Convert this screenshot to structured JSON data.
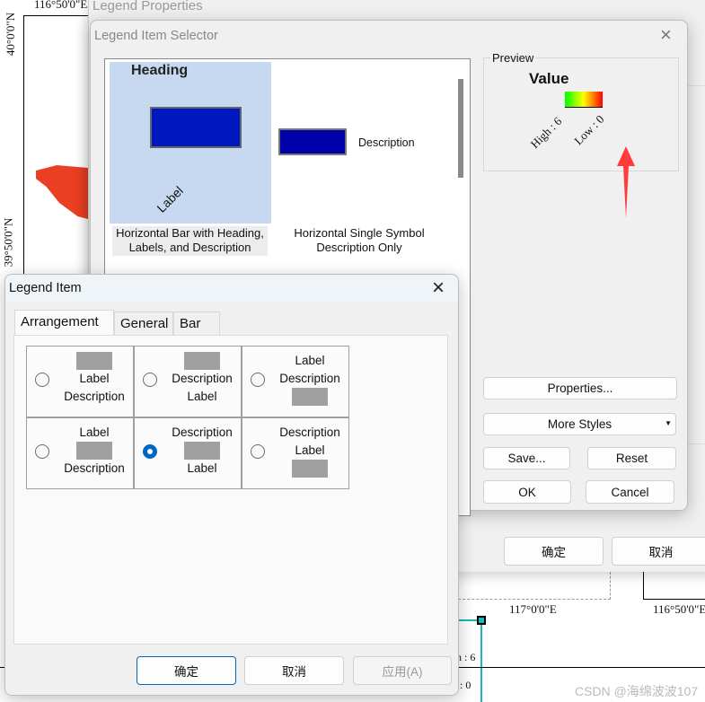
{
  "map": {
    "top_lon": "116°50'0\"E",
    "lat_top": "40°0'0\"N",
    "lat_bottom": "39°50'0\"N",
    "bottom_lon1": "117°0'0\"E",
    "bottom_lon2": "116°50'0\"E",
    "legend_high": "n : 6",
    "legend_low": ": 0",
    "accent": "#1ab8b8"
  },
  "legend_properties": {
    "title": "Legend Properties",
    "ok": "确定",
    "cancel": "取消"
  },
  "selector": {
    "title": "Legend Item Selector",
    "items": [
      {
        "heading": "Heading",
        "label": "Label",
        "caption": "Horizontal Bar with Heading, Labels, and Description"
      },
      {
        "description": "Description",
        "caption": "Horizontal Single Symbol Description Only"
      }
    ],
    "preview": {
      "group": "Preview",
      "title": "Value",
      "high": "High : 6",
      "low": "Low : 0",
      "gradient": [
        "#00ff00",
        "#ffff00",
        "#ff0000"
      ]
    },
    "buttons": {
      "properties": "Properties...",
      "more_styles": "More Styles",
      "save": "Save...",
      "reset": "Reset",
      "ok": "OK",
      "cancel": "Cancel"
    }
  },
  "legend_item": {
    "title": "Legend Item",
    "tabs": [
      {
        "label": "Arrangement",
        "active": true
      },
      {
        "label": "General"
      },
      {
        "label": "Bar"
      }
    ],
    "arrangements": [
      {
        "rows": [
          "patch",
          "Label",
          "Description"
        ],
        "selected": false
      },
      {
        "rows": [
          "patch",
          "Description",
          "Label"
        ],
        "selected": false
      },
      {
        "rows": [
          "Label",
          "Description",
          "patch"
        ],
        "selected": false
      },
      {
        "rows": [
          "Label",
          "patch",
          "Description"
        ],
        "selected": false
      },
      {
        "rows": [
          "Description",
          "patch",
          "Label"
        ],
        "selected": true
      },
      {
        "rows": [
          "Description",
          "Label",
          "patch"
        ],
        "selected": false
      }
    ],
    "ok": "确定",
    "cancel": "取消",
    "apply": "应用(A)"
  },
  "watermark": "CSDN @海绵波波107"
}
